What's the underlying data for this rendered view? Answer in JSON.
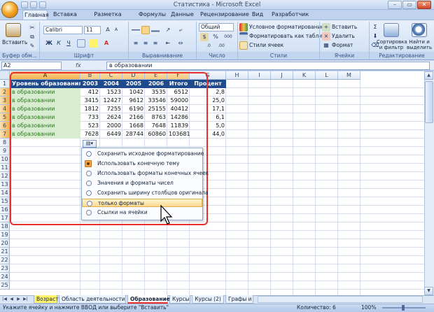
{
  "window": {
    "title": "Статистика - Microsoft Excel",
    "minimize": "–",
    "maximize": "▭",
    "close": "✕"
  },
  "tabs": [
    "Главная",
    "Вставка",
    "Разметка страницы",
    "Формулы",
    "Данные",
    "Рецензирование",
    "Вид",
    "Разработчик"
  ],
  "ribbon": {
    "clipboard": {
      "paste": "Вставить",
      "label": "Буфер обм..."
    },
    "font": {
      "name": "Calibri",
      "size": "11",
      "bold": "Ж",
      "italic": "К",
      "underline": "Ч",
      "label": "Шрифт"
    },
    "alignment": {
      "label": "Выравнивание"
    },
    "number": {
      "format": "Общий",
      "percent": "%",
      "thousands": "000",
      "label": "Число"
    },
    "styles": {
      "conditional": "Условное форматирование",
      "as_table": "Форматировать как таблицу",
      "cell_styles": "Стили ячеек",
      "label": "Стили"
    },
    "cells": {
      "insert": "Вставить",
      "delete": "Удалить",
      "format": "Формат",
      "label": "Ячейки"
    },
    "editing": {
      "sort": "Сортировка",
      "sort2": "и фильтр",
      "find": "Найти и",
      "find2": "выделить",
      "label": "Редактирование"
    }
  },
  "formula_bar": {
    "name_box": "A2",
    "fx": "fx",
    "value": "в образовании"
  },
  "columns": [
    "A",
    "B",
    "C",
    "D",
    "E",
    "F",
    "G",
    "H",
    "I",
    "J",
    "K",
    "L",
    "M"
  ],
  "rows": [
    "1",
    "2",
    "3",
    "4",
    "5",
    "6",
    "7",
    "8",
    "9",
    "10",
    "11",
    "12",
    "13",
    "14",
    "15",
    "16",
    "17",
    "18",
    "19",
    "20",
    "21",
    "22",
    "23",
    "24",
    "25"
  ],
  "table": {
    "headers": [
      "Уровень образования",
      "2003",
      "2004",
      "2005",
      "2006",
      "Итого",
      "Процент"
    ],
    "rows": [
      [
        "в образовании",
        "412",
        "1523",
        "1042",
        "3535",
        "6512",
        "2,8"
      ],
      [
        "в образовании",
        "3415",
        "12427",
        "9612",
        "33546",
        "59000",
        "25,0"
      ],
      [
        "в образовании",
        "1812",
        "7255",
        "6190",
        "25155",
        "40412",
        "17,1"
      ],
      [
        "в образовании",
        "733",
        "2624",
        "2166",
        "8763",
        "14286",
        "6,1"
      ],
      [
        "в образовании",
        "523",
        "2000",
        "1668",
        "7648",
        "11839",
        "5,0"
      ],
      [
        "в образовании",
        "7628",
        "6449",
        "28744",
        "60860",
        "103681",
        "44,0"
      ]
    ]
  },
  "paste_menu": {
    "button": "▾",
    "items": [
      "Сохранить исходное форматирование",
      "Использовать конечную тему",
      "Использовать форматы конечных ячеек",
      "Значения и форматы чисел",
      "Сохранить ширину столбцов оригинала",
      "только форматы",
      "Ссылки на ячейки"
    ]
  },
  "sheets": [
    "Возраст",
    "Область деятельности",
    "Образование",
    "Курсы",
    "Курсы (2)",
    "Графы и"
  ],
  "status": {
    "message": "Укажите ячейку и нажмите ВВОД или выберите \"Вставить\"",
    "count": "Количество: 6",
    "zoom": "100%"
  },
  "colors": {
    "header_bg": "#1f4b8c",
    "selected_fill": "#d8ecd0",
    "selected_text": "#2f7a1e",
    "highlight_border": "#e7302a"
  }
}
